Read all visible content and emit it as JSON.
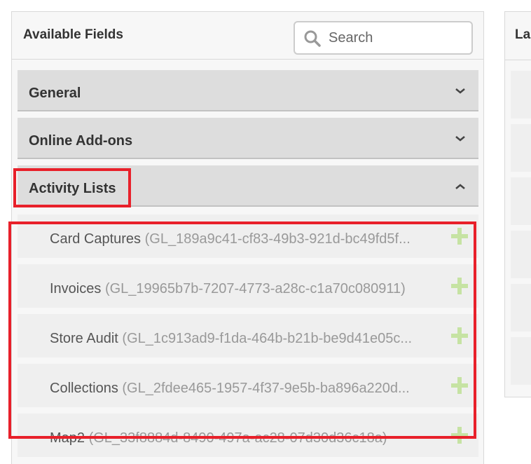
{
  "available_fields": {
    "title": "Available Fields",
    "search": {
      "placeholder": "Search",
      "value": ""
    },
    "sections": [
      {
        "label": "General",
        "expanded": false
      },
      {
        "label": "Online Add-ons",
        "expanded": false
      },
      {
        "label": "Activity Lists",
        "expanded": true
      }
    ],
    "activity_list_items": [
      {
        "name": "Card Captures",
        "id": "(GL_189a9c41-cf83-49b3-921d-bc49fd5f..."
      },
      {
        "name": "Invoices",
        "id": "(GL_19965b7b-7207-4773-a28c-c1a70c080911)"
      },
      {
        "name": "Store Audit",
        "id": "(GL_1c913ad9-f1da-464b-b21b-be9d41e05c..."
      },
      {
        "name": "Collections",
        "id": "(GL_2fdee465-1957-4f37-9e5b-ba896a220d..."
      },
      {
        "name": "Map2",
        "id": "(GL_33f8884d-8490-497a-ac28-07d30d36c18a)"
      }
    ]
  },
  "layout_panel": {
    "title": "La"
  },
  "colors": {
    "highlight": "#e8202a",
    "add_icon": "#c6e3a3",
    "section_bg": "#dddddd",
    "item_bg": "#efefef"
  }
}
